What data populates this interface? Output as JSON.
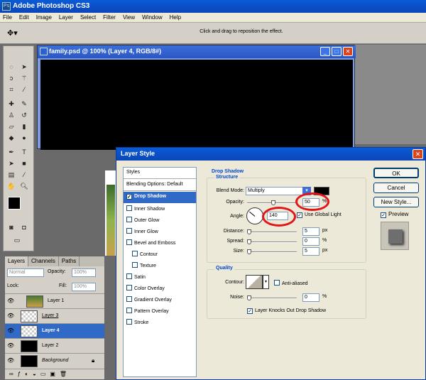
{
  "app": {
    "title": "Adobe Photoshop CS3",
    "logo": "Ps"
  },
  "menu": [
    "File",
    "Edit",
    "Image",
    "Layer",
    "Select",
    "Filter",
    "View",
    "Window",
    "Help"
  ],
  "options_hint": "Click and drag to reposition the effect.",
  "document": {
    "title": "family.psd @ 100% (Layer 4, RGB/8#)"
  },
  "layers_panel": {
    "tabs": [
      "Layers",
      "Channels",
      "Paths"
    ],
    "blend_mode": "Normal",
    "opacity_label": "Opacity:",
    "opacity_value": "100%",
    "lock_label": "Lock:",
    "fill_label": "Fill:",
    "fill_value": "100%",
    "layers": [
      {
        "name": "Layer 1"
      },
      {
        "name": "Layer 3"
      },
      {
        "name": "Layer 4"
      },
      {
        "name": "Layer 2"
      },
      {
        "name": "Background"
      }
    ]
  },
  "dialog": {
    "title": "Layer Style",
    "styles_header": "Styles",
    "blending": "Blending Options: Default",
    "styles": [
      "Drop Shadow",
      "Inner Shadow",
      "Outer Glow",
      "Inner Glow",
      "Bevel and Emboss",
      "Contour",
      "Texture",
      "Satin",
      "Color Overlay",
      "Gradient Overlay",
      "Pattern Overlay",
      "Stroke"
    ],
    "section_title": "Drop Shadow",
    "structure_label": "Structure",
    "blend_mode_label": "Blend Mode:",
    "blend_mode_value": "Multiply",
    "shadow_color": "#000000",
    "opacity_label": "Opacity:",
    "opacity_value": "50",
    "angle_label": "Angle:",
    "angle_value": "140",
    "use_global_light": "Use Global Light",
    "distance_label": "Distance:",
    "distance_value": "5",
    "spread_label": "Spread:",
    "spread_value": "0",
    "size_label": "Size:",
    "size_value": "5",
    "unit_px": "px",
    "unit_pct": "%",
    "unit_deg": "°",
    "quality_label": "Quality",
    "contour_label": "Contour:",
    "anti_aliased": "Anti-aliased",
    "noise_label": "Noise:",
    "noise_value": "0",
    "knockout": "Layer Knocks Out Drop Shadow",
    "ok": "OK",
    "cancel": "Cancel",
    "new_style": "New Style...",
    "preview": "Preview"
  },
  "colors": {
    "highlight": "#e0161a",
    "selection": "#3169c6",
    "xp_title": "#0a5bd6"
  }
}
